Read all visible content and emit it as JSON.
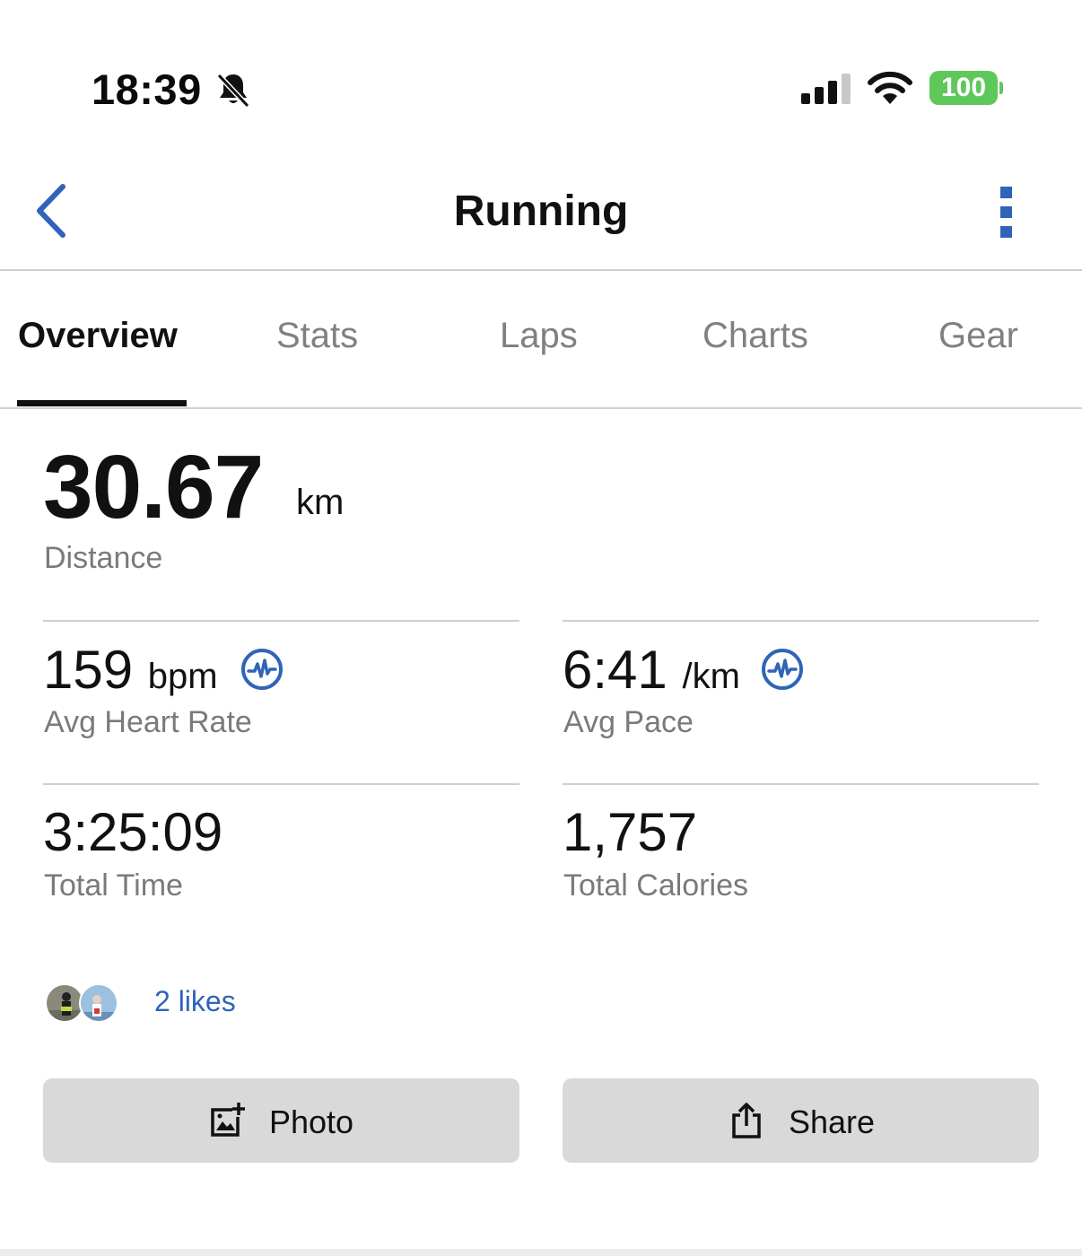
{
  "status_bar": {
    "time": "18:39",
    "battery": "100",
    "icons": [
      "bell-slash-icon",
      "cellular-signal-icon",
      "wifi-icon",
      "battery-icon"
    ]
  },
  "header": {
    "title": "Running",
    "back_icon": "chevron-left-icon",
    "more_icon": "vertical-dots-icon"
  },
  "tabs": [
    {
      "label": "Overview",
      "active": true
    },
    {
      "label": "Stats",
      "active": false
    },
    {
      "label": "Laps",
      "active": false
    },
    {
      "label": "Charts",
      "active": false
    },
    {
      "label": "Gear",
      "active": false
    }
  ],
  "distance": {
    "value": "30.67",
    "unit": "km",
    "label": "Distance"
  },
  "stats": {
    "heart_rate": {
      "value": "159",
      "unit": "bpm",
      "label": "Avg Heart Rate",
      "icon": "heart-rate-pulse-icon"
    },
    "pace": {
      "value": "6:41",
      "unit": "/km",
      "label": "Avg Pace",
      "icon": "heart-rate-pulse-icon"
    },
    "time": {
      "value": "3:25:09",
      "label": "Total Time"
    },
    "calories": {
      "value": "1,757",
      "label": "Total Calories"
    }
  },
  "likes": {
    "text": "2 likes"
  },
  "buttons": {
    "photo": {
      "label": "Photo",
      "icon": "add-photo-icon"
    },
    "share": {
      "label": "Share",
      "icon": "share-icon"
    }
  },
  "colors": {
    "accent": "#2f64b8",
    "battery": "#5fc85a",
    "button_bg": "#d9d9d9",
    "secondary_text": "#7a7a7a"
  }
}
